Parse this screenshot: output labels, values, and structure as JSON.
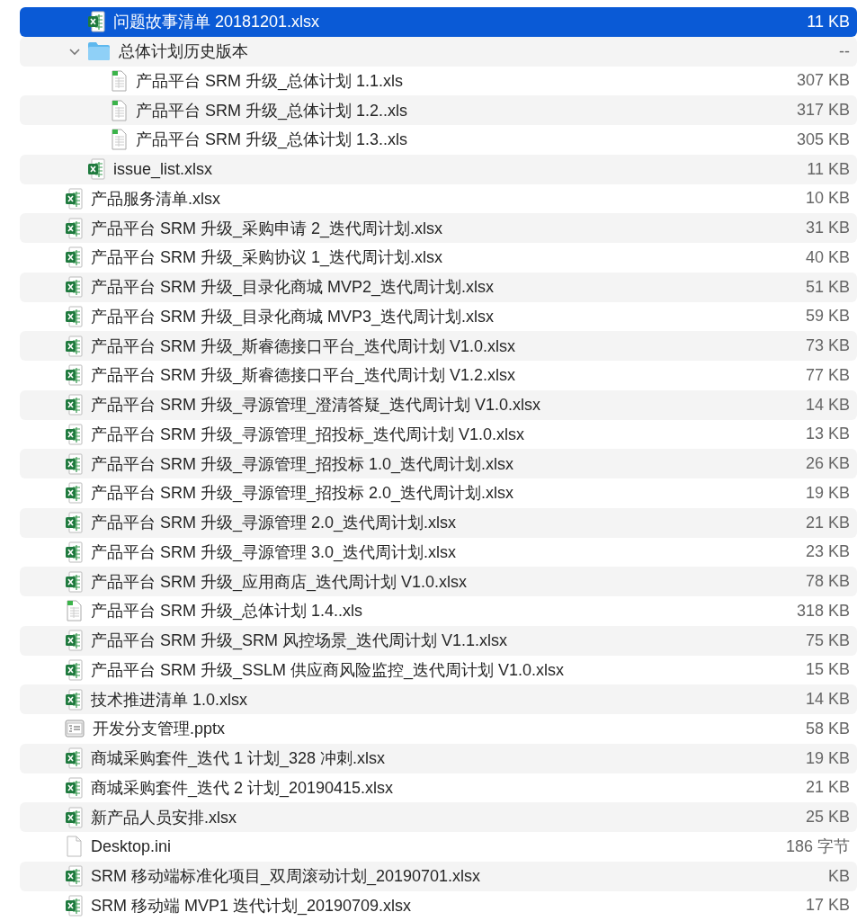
{
  "file_list": {
    "continued_children": [
      {
        "kind": "excel",
        "name": "问题故事清单 20181201.xlsx",
        "size": "11 KB",
        "selected": true
      },
      {
        "kind": "folder",
        "name": "总体计划历史版本",
        "size": "--",
        "selected": false,
        "expanded": true,
        "children": [
          {
            "kind": "sheet",
            "name": "产品平台 SRM 升级_总体计划 1.1.xls",
            "size": "307 KB",
            "selected": false
          },
          {
            "kind": "sheet",
            "name": "产品平台 SRM 升级_总体计划 1.2..xls",
            "size": "317 KB",
            "selected": false
          },
          {
            "kind": "sheet",
            "name": "产品平台 SRM 升级_总体计划 1.3..xls",
            "size": "305 KB",
            "selected": false
          }
        ]
      },
      {
        "kind": "excel",
        "name": "issue_list.xlsx",
        "size": "11 KB",
        "selected": false
      }
    ],
    "items": [
      {
        "kind": "excel",
        "name": "产品服务清单.xlsx",
        "size": "10 KB",
        "selected": false
      },
      {
        "kind": "excel",
        "name": "产品平台 SRM 升级_采购申请 2_迭代周计划.xlsx",
        "size": "31 KB",
        "selected": false
      },
      {
        "kind": "excel",
        "name": "产品平台 SRM 升级_采购协议 1_迭代周计划.xlsx",
        "size": "40 KB",
        "selected": false
      },
      {
        "kind": "excel",
        "name": "产品平台 SRM 升级_目录化商城 MVP2_迭代周计划.xlsx",
        "size": "51 KB",
        "selected": false
      },
      {
        "kind": "excel",
        "name": "产品平台 SRM 升级_目录化商城 MVP3_迭代周计划.xlsx",
        "size": "59 KB",
        "selected": false
      },
      {
        "kind": "excel",
        "name": "产品平台 SRM 升级_斯睿德接口平台_迭代周计划 V1.0.xlsx",
        "size": "73 KB",
        "selected": false
      },
      {
        "kind": "excel",
        "name": "产品平台 SRM 升级_斯睿德接口平台_迭代周计划 V1.2.xlsx",
        "size": "77 KB",
        "selected": false
      },
      {
        "kind": "excel",
        "name": "产品平台 SRM 升级_寻源管理_澄清答疑_迭代周计划 V1.0.xlsx",
        "size": "14 KB",
        "selected": false
      },
      {
        "kind": "excel",
        "name": "产品平台 SRM 升级_寻源管理_招投标_迭代周计划 V1.0.xlsx",
        "size": "13 KB",
        "selected": false
      },
      {
        "kind": "excel",
        "name": "产品平台 SRM 升级_寻源管理_招投标 1.0_迭代周计划.xlsx",
        "size": "26 KB",
        "selected": false
      },
      {
        "kind": "excel",
        "name": "产品平台 SRM 升级_寻源管理_招投标 2.0_迭代周计划.xlsx",
        "size": "19 KB",
        "selected": false
      },
      {
        "kind": "excel",
        "name": "产品平台 SRM 升级_寻源管理 2.0_迭代周计划.xlsx",
        "size": "21 KB",
        "selected": false
      },
      {
        "kind": "excel",
        "name": "产品平台 SRM 升级_寻源管理 3.0_迭代周计划.xlsx",
        "size": "23 KB",
        "selected": false
      },
      {
        "kind": "excel",
        "name": "产品平台 SRM 升级_应用商店_迭代周计划 V1.0.xlsx",
        "size": "78 KB",
        "selected": false
      },
      {
        "kind": "sheet",
        "name": "产品平台 SRM 升级_总体计划 1.4..xls",
        "size": "318 KB",
        "selected": false
      },
      {
        "kind": "excel",
        "name": "产品平台 SRM 升级_SRM 风控场景_迭代周计划 V1.1.xlsx",
        "size": "75 KB",
        "selected": false
      },
      {
        "kind": "excel",
        "name": "产品平台 SRM 升级_SSLM 供应商风险监控_迭代周计划 V1.0.xlsx",
        "size": "15 KB",
        "selected": false
      },
      {
        "kind": "excel",
        "name": "技术推进清单 1.0.xlsx",
        "size": "14 KB",
        "selected": false
      },
      {
        "kind": "pptx",
        "name": "开发分支管理.pptx",
        "size": "58 KB",
        "selected": false
      },
      {
        "kind": "excel",
        "name": "商城采购套件_迭代 1 计划_328 冲刺.xlsx",
        "size": "19 KB",
        "selected": false
      },
      {
        "kind": "excel",
        "name": "商城采购套件_迭代 2 计划_20190415.xlsx",
        "size": "21 KB",
        "selected": false
      },
      {
        "kind": "excel",
        "name": "新产品人员安排.xlsx",
        "size": "25 KB",
        "selected": false
      },
      {
        "kind": "blank",
        "name": "Desktop.ini",
        "size": "186 字节",
        "selected": false
      },
      {
        "kind": "excel",
        "name": "SRM 移动端标准化项目_双周滚动计划_20190701.xlsx",
        "size": "KB",
        "selected": false
      },
      {
        "kind": "excel",
        "name": "SRM 移动端 MVP1 迭代计划_20190709.xlsx",
        "size": "17 KB",
        "selected": false
      }
    ]
  }
}
